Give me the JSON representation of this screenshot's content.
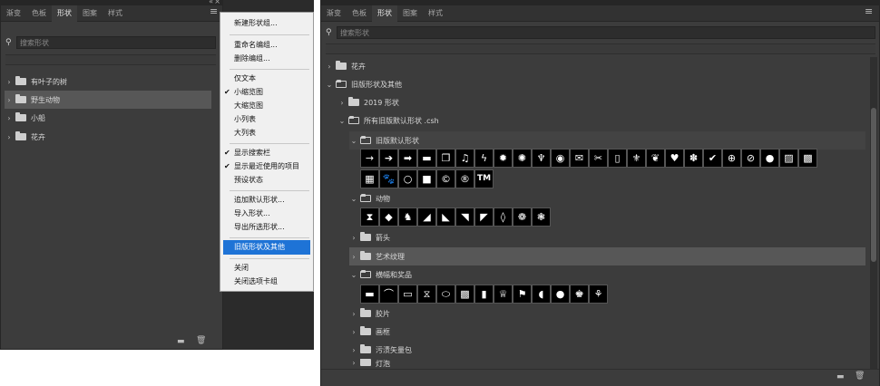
{
  "left_panel": {
    "tabs": [
      "渐变",
      "色板",
      "形状",
      "图案",
      "样式"
    ],
    "active_tab": "形状",
    "search_placeholder": "搜索形状",
    "groups": [
      {
        "label": "有叶子的树",
        "selected": false
      },
      {
        "label": "野生动物",
        "selected": true
      },
      {
        "label": "小船",
        "selected": false
      },
      {
        "label": "花卉",
        "selected": false
      }
    ]
  },
  "context_menu": {
    "items": [
      {
        "label": "新建形状组...",
        "checked": false,
        "highlighted": false
      },
      {
        "label": "重命名编组...",
        "checked": false,
        "highlighted": false
      },
      {
        "label": "删除编组...",
        "checked": false,
        "highlighted": false
      },
      {
        "label": "仅文本",
        "checked": false,
        "highlighted": false
      },
      {
        "label": "小缩览图",
        "checked": true,
        "highlighted": false
      },
      {
        "label": "大缩览图",
        "checked": false,
        "highlighted": false
      },
      {
        "label": "小列表",
        "checked": false,
        "highlighted": false
      },
      {
        "label": "大列表",
        "checked": false,
        "highlighted": false
      },
      {
        "label": "显示搜索栏",
        "checked": true,
        "highlighted": false
      },
      {
        "label": "显示最近使用的项目",
        "checked": true,
        "highlighted": false
      },
      {
        "label": "预设状态",
        "checked": false,
        "highlighted": false
      },
      {
        "label": "追加默认形状...",
        "checked": false,
        "highlighted": false
      },
      {
        "label": "导入形状...",
        "checked": false,
        "highlighted": false
      },
      {
        "label": "导出所选形状...",
        "checked": false,
        "highlighted": false
      },
      {
        "label": "旧版形状及其他",
        "checked": false,
        "highlighted": true
      },
      {
        "label": "关闭",
        "checked": false,
        "highlighted": false
      },
      {
        "label": "关闭选项卡组",
        "checked": false,
        "highlighted": false
      }
    ],
    "highlight_color": "#1e73d6"
  },
  "right_panel": {
    "tabs": [
      "渐变",
      "色板",
      "形状",
      "图案",
      "样式"
    ],
    "active_tab": "形状",
    "search_placeholder": "搜索形状",
    "tree": [
      {
        "label": "花卉",
        "expanded": false,
        "level": 0
      },
      {
        "label": "旧版形状及其他",
        "expanded": true,
        "level": 0
      },
      {
        "label": "2019 形状",
        "expanded": false,
        "level": 1
      },
      {
        "label": "所有旧版默认形状 .csh",
        "expanded": true,
        "level": 1
      },
      {
        "label": "旧版默认形状",
        "expanded": true,
        "level": 2
      },
      {
        "label": "动物",
        "expanded": true,
        "level": 2
      },
      {
        "label": "箭头",
        "expanded": false,
        "level": 2
      },
      {
        "label": "艺术纹理",
        "expanded": false,
        "level": 2
      },
      {
        "label": "横幅和奖品",
        "expanded": true,
        "level": 2
      },
      {
        "label": "胶片",
        "expanded": false,
        "level": 2
      },
      {
        "label": "画框",
        "expanded": false,
        "level": 2
      },
      {
        "label": "污渍矢量包",
        "expanded": false,
        "level": 2
      },
      {
        "label": "灯泡",
        "expanded": false,
        "level": 2
      }
    ],
    "legacy_shapes_row1": [
      "→",
      "➔",
      "➡",
      "▬",
      "❐",
      "♫",
      "ϟ",
      "✹",
      "✺",
      "♆",
      "◉",
      "✉",
      "✂",
      "▯",
      "⚜",
      "❦",
      "♥",
      "✽",
      "✔",
      "⊕",
      "⊘",
      "●",
      "▨",
      "▩"
    ],
    "legacy_shapes_row2": [
      "▦",
      "🐾",
      "○",
      "■",
      "©",
      "®",
      "TM"
    ],
    "animal_shapes": [
      "⧗",
      "◆",
      "♞",
      "◢",
      "◣",
      "◥",
      "◤",
      "◊",
      "❁",
      "❃"
    ],
    "banner_shapes": [
      "▬",
      "⌒",
      "▭",
      "⧖",
      "⬭",
      "▩",
      "▮",
      "♕",
      "⚑",
      "◖",
      "●",
      "♚",
      "⚘"
    ],
    "legacy_shapes_row2_text": [
      "",
      "",
      "",
      "",
      "©",
      "®",
      "TM"
    ]
  }
}
